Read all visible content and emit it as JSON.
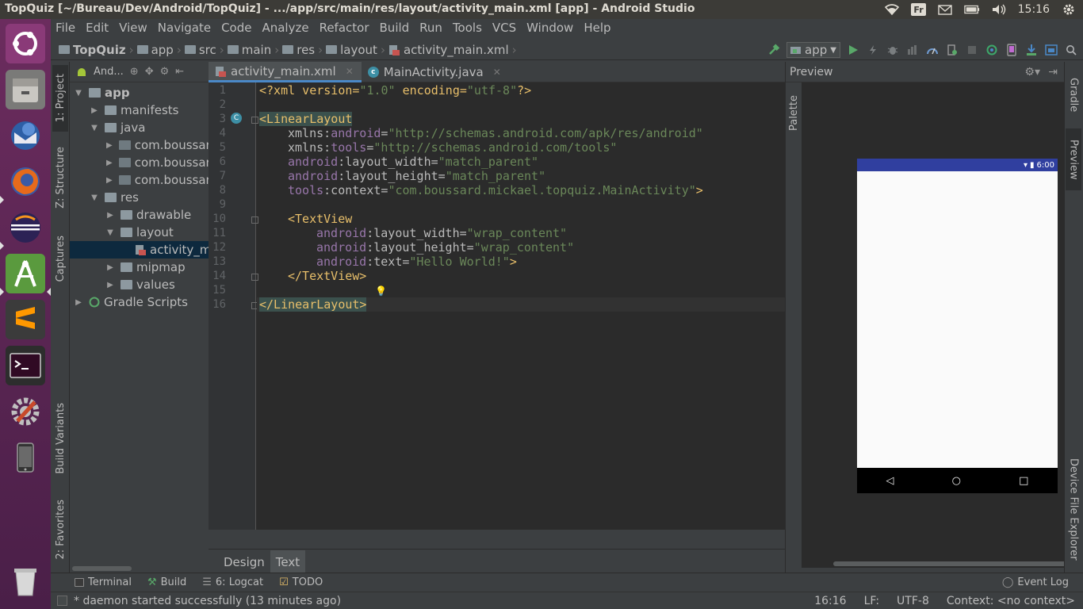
{
  "top_bar": {
    "window_title": "TopQuiz [~/Bureau/Dev/Android/TopQuiz] - .../app/src/main/res/layout/activity_main.xml [app] - Android Studio",
    "keyboard_layout": "Fr",
    "clock": "15:16"
  },
  "launcher": {
    "items": [
      "Ubuntu Dash",
      "Files",
      "Thunderbird",
      "Firefox",
      "Eclipse",
      "Android Studio",
      "Sublime Text",
      "Terminal",
      "System Settings",
      "Phone",
      "Trash"
    ]
  },
  "menu": [
    "File",
    "Edit",
    "View",
    "Navigate",
    "Code",
    "Analyze",
    "Refactor",
    "Build",
    "Run",
    "Tools",
    "VCS",
    "Window",
    "Help"
  ],
  "breadcrumb": [
    "TopQuiz",
    "app",
    "src",
    "main",
    "res",
    "layout",
    "activity_main.xml"
  ],
  "run_config": "app",
  "left_tabs": [
    "1: Project",
    "Z: Structure",
    "Captures",
    "Build Variants",
    "2: Favorites"
  ],
  "project": {
    "view_mode": "And...",
    "tree": [
      {
        "label": "app",
        "level": 0,
        "expanded": true
      },
      {
        "label": "manifests",
        "level": 1,
        "expanded": false
      },
      {
        "label": "java",
        "level": 1,
        "expanded": true
      },
      {
        "label": "com.boussard",
        "level": 2,
        "expanded": false
      },
      {
        "label": "com.boussard",
        "level": 2,
        "expanded": false
      },
      {
        "label": "com.boussard",
        "level": 2,
        "expanded": false
      },
      {
        "label": "res",
        "level": 1,
        "expanded": true
      },
      {
        "label": "drawable",
        "level": 2,
        "expanded": false
      },
      {
        "label": "layout",
        "level": 2,
        "expanded": true
      },
      {
        "label": "activity_ma",
        "level": 3,
        "selected": true
      },
      {
        "label": "mipmap",
        "level": 2,
        "expanded": false
      },
      {
        "label": "values",
        "level": 2,
        "expanded": false
      },
      {
        "label": "Gradle Scripts",
        "level": 0,
        "expanded": false
      }
    ]
  },
  "editor": {
    "tabs": [
      {
        "label": "activity_main.xml",
        "active": true
      },
      {
        "label": "MainActivity.java",
        "active": false
      }
    ],
    "line_numbers": [
      "1",
      "2",
      "3",
      "4",
      "5",
      "6",
      "7",
      "8",
      "9",
      "10",
      "11",
      "12",
      "13",
      "14",
      "15",
      "16"
    ],
    "code": {
      "l1_a": "<?xml version=",
      "l1_b": "\"1.0\"",
      "l1_c": " encoding=",
      "l1_d": "\"utf-8\"",
      "l1_e": "?>",
      "l3": "<LinearLayout",
      "l4_ns1": "xmlns:",
      "l4_ns2": "android",
      "l4_eq": "=",
      "l4_val": "\"http://schemas.android.com/apk/res/android\"",
      "l5_ns1": "xmlns:",
      "l5_ns2": "tools",
      "l5_eq": "=",
      "l5_val": "\"http://schemas.android.com/tools\"",
      "l6_ns": "android",
      "l6_attr": ":layout_width=",
      "l6_val": "\"match_parent\"",
      "l7_ns": "android",
      "l7_attr": ":layout_height=",
      "l7_val": "\"match_parent\"",
      "l8_ns": "tools",
      "l8_attr": ":context=",
      "l8_val": "\"com.boussard.mickael.topquiz.MainActivity\"",
      "l8_end": ">",
      "l10": "<TextView",
      "l11_ns": "android",
      "l11_attr": ":layout_width=",
      "l11_val": "\"wrap_content\"",
      "l12_ns": "android",
      "l12_attr": ":layout_height=",
      "l12_val": "\"wrap_content\"",
      "l13_ns": "android",
      "l13_attr": ":text=",
      "l13_val": "\"Hello World!\"",
      "l13_end": ">",
      "l14": "</TextView>",
      "l16": "</LinearLayout>"
    },
    "bottom_tabs": [
      "Design",
      "Text"
    ],
    "active_bottom_tab": "Text"
  },
  "preview": {
    "title": "Preview",
    "palette_label": "Palette",
    "phone_time": "6:00",
    "phone_status_color": "#303f9f"
  },
  "right_tabs": [
    "Gradle",
    "Preview",
    "Device File Explorer"
  ],
  "bottom_tools": [
    "Terminal",
    "Build",
    "6: Logcat",
    "TODO"
  ],
  "event_log": "Event Log",
  "status": {
    "message": "* daemon started successfully (13 minutes ago)",
    "position": "16:16",
    "line_sep": "LF:",
    "encoding": "UTF-8",
    "context": "Context: <no context>"
  },
  "colors": {
    "ubuntu_panel": "#3c3b37",
    "launcher": "#5e2750",
    "ide_bg": "#3c3f41",
    "editor_bg": "#2b2b2b",
    "tag": "#e8bf6a",
    "string": "#6a8759",
    "namespace": "#9876aa"
  }
}
